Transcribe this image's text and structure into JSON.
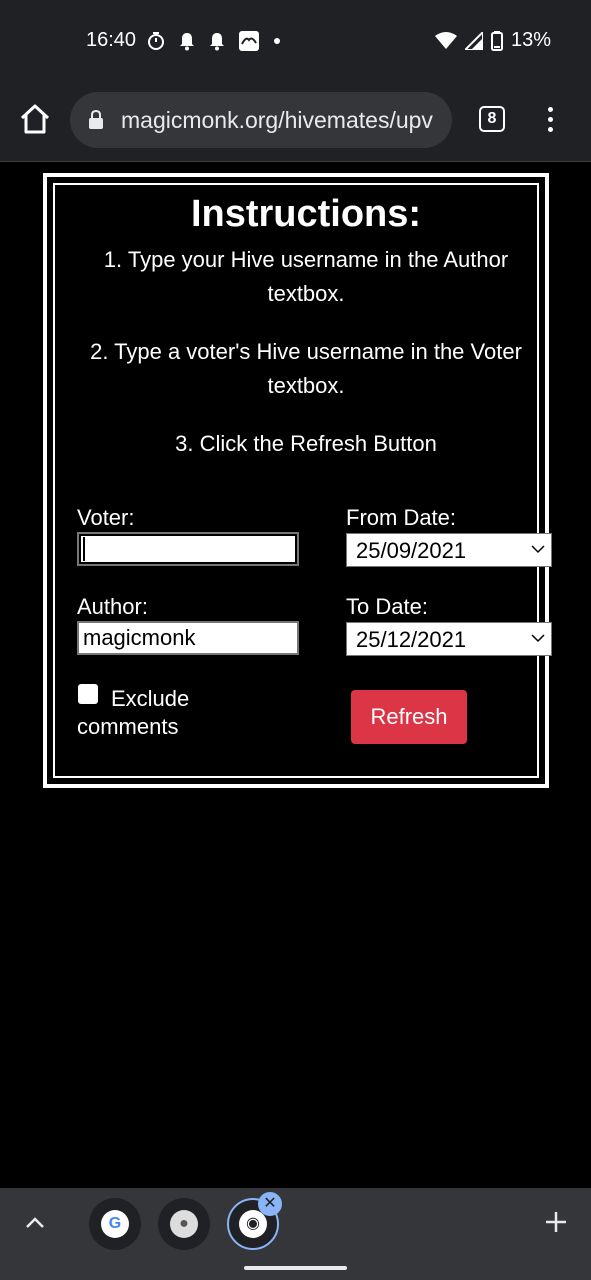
{
  "status_bar": {
    "time": "16:40",
    "battery": "13%",
    "icons": [
      "timer-icon",
      "notification-bell-icon",
      "notification-bell-icon",
      "app-notification-icon",
      "dot-icon",
      "wifi-icon",
      "signal-icon",
      "battery-icon"
    ]
  },
  "browser": {
    "url": "magicmonk.org/hivemates/upv",
    "tab_count": "8"
  },
  "page": {
    "title": "Instructions:",
    "step1": "1. Type your Hive username in the Author textbox.",
    "step2": "2. Type a voter's Hive username in the Voter textbox.",
    "step3": "3. Click the Refresh Button",
    "voter_label": "Voter:",
    "voter_value": "",
    "author_label": "Author:",
    "author_value": "magicmonk",
    "from_label": "From Date:",
    "from_value": "25/09/2021",
    "to_label": "To Date:",
    "to_value": "25/12/2021",
    "exclude_label": "Exclude comments",
    "exclude_checked": false,
    "refresh_label": "Refresh"
  },
  "tab_strip": {
    "tabs": [
      {
        "icon": "google-icon",
        "glyph": "G"
      },
      {
        "icon": "site-favicon-icon",
        "glyph": "●"
      },
      {
        "icon": "hive-favicon-icon",
        "glyph": "◉"
      }
    ]
  },
  "colors": {
    "refresh_button": "#dc3545",
    "active_tab_ring": "#8ab4f8"
  }
}
